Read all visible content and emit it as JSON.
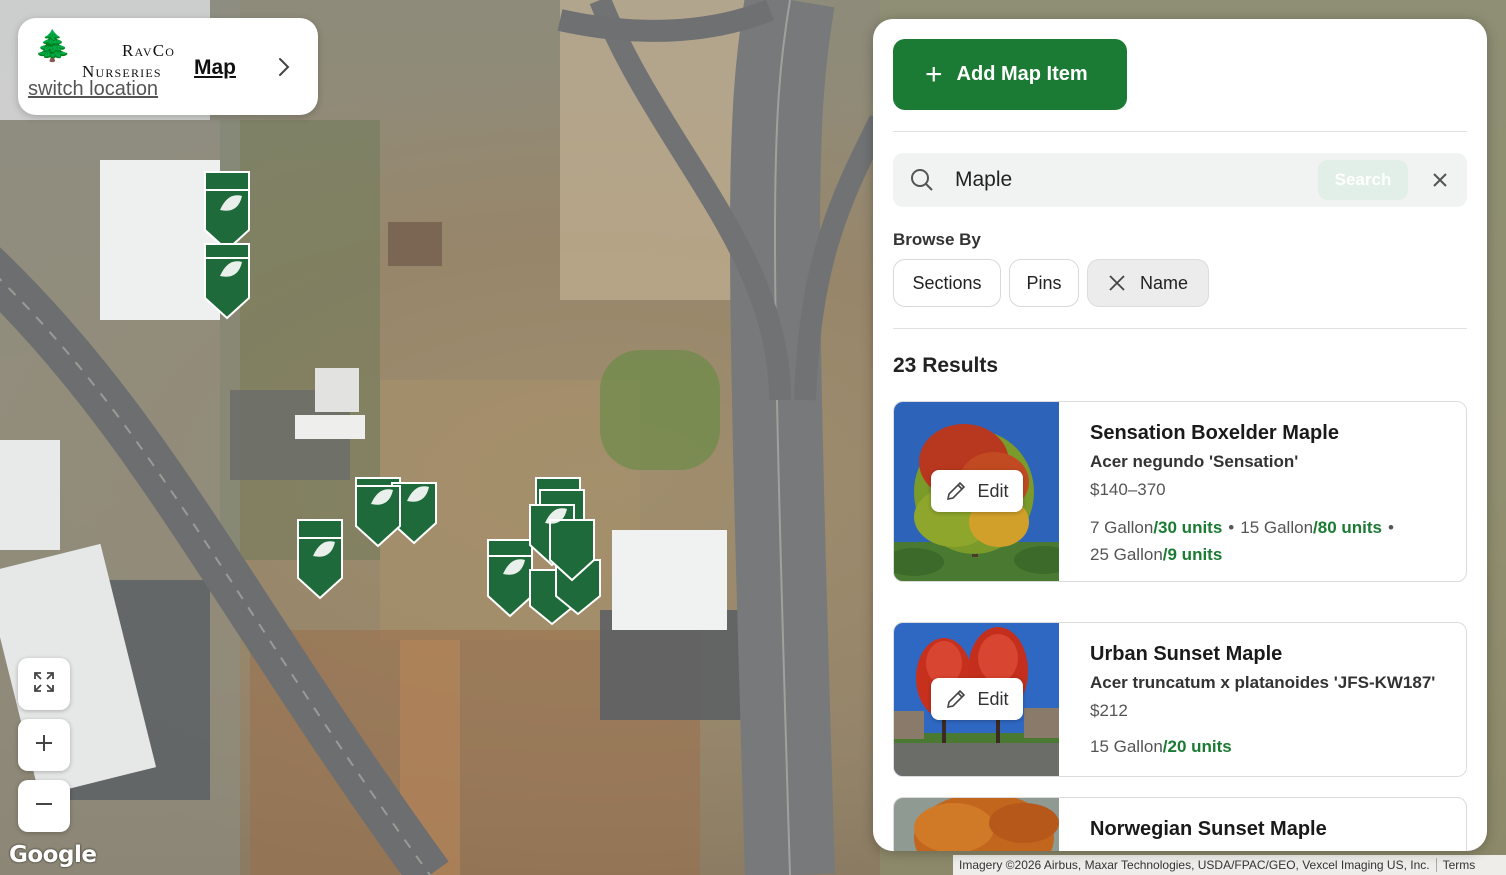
{
  "brand": {
    "line1": "RavCo",
    "line2": "Nurseries",
    "switch_location": "switch location",
    "map_link": "Map"
  },
  "map": {
    "google_logo": "Google",
    "attribution": "Imagery ©2026 Airbus, Maxar Technologies, USDA/FPAC/GEO, Vexcel Imaging US, Inc.",
    "terms": "Terms",
    "controls": [
      "fullscreen-icon",
      "plus-icon",
      "minus-icon"
    ],
    "pin_color": "#1e6a3a"
  },
  "panel": {
    "add_button": "Add Map Item",
    "search": {
      "value": "Maple",
      "button": "Search"
    },
    "browse_by": {
      "label": "Browse By",
      "chips": [
        {
          "label": "Sections",
          "active": false
        },
        {
          "label": "Pins",
          "active": false
        },
        {
          "label": "Name",
          "active": true
        }
      ]
    },
    "results_count": "23 Results",
    "edit_label": "Edit",
    "results": [
      {
        "name": "Sensation Boxelder Maple",
        "scientific": "Acer negundo 'Sensation'",
        "price": "$140–370",
        "inventory": [
          {
            "size": "7 Gallon",
            "units": "/30 units"
          },
          {
            "size": "15 Gallon",
            "units": "/80 units"
          },
          {
            "size": "25 Gallon",
            "units": "/9 units"
          }
        ]
      },
      {
        "name": "Urban Sunset Maple",
        "scientific": "Acer truncatum x platanoides 'JFS-KW187'",
        "price": "$212",
        "inventory": [
          {
            "size": "15 Gallon",
            "units": "/20 units"
          }
        ]
      },
      {
        "name": "Norwegian Sunset Maple",
        "scientific": "",
        "price": "",
        "inventory": []
      }
    ]
  },
  "colors": {
    "brand_green": "#1b7a33",
    "units_green": "#1b7a33"
  }
}
